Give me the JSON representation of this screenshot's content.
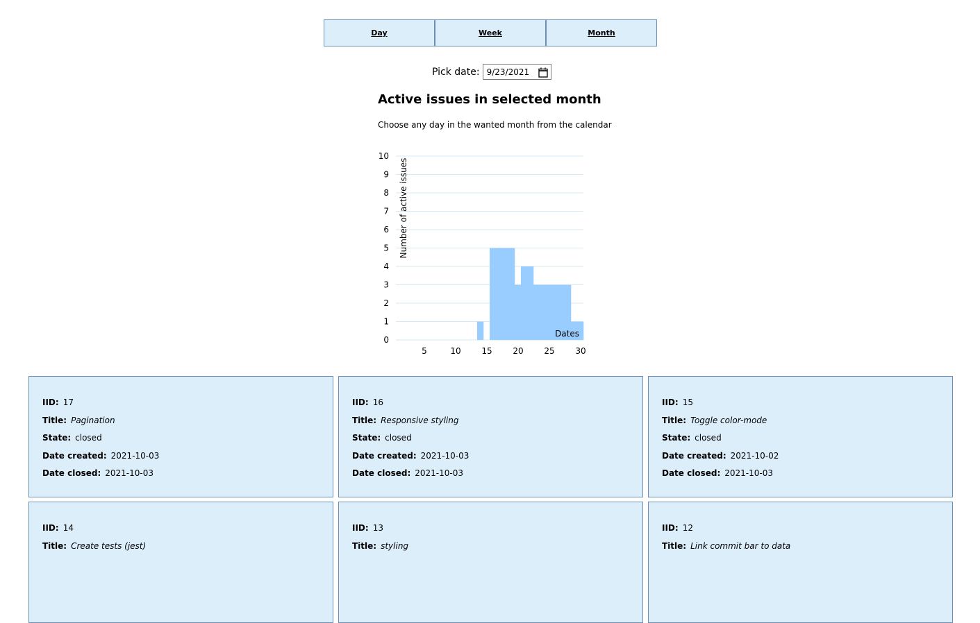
{
  "tabs": [
    {
      "label": "Day"
    },
    {
      "label": "Week"
    },
    {
      "label": "Month"
    }
  ],
  "datepicker": {
    "label": "Pick date:",
    "value": "9/23/2021",
    "icon": "calendar-icon"
  },
  "heading": "Active issues in selected month",
  "subtext": "Choose any day in the wanted month from the calendar",
  "labels": {
    "iid": "IID:",
    "title": "Title:",
    "state": "State:",
    "created": "Date created:",
    "closed": "Date closed:"
  },
  "chart_data": {
    "type": "area",
    "title": "",
    "xlabel": "Dates",
    "ylabel": "Number of active issues",
    "xlim": [
      1,
      30
    ],
    "ylim": [
      0,
      10
    ],
    "xticks": [
      5,
      10,
      15,
      20,
      25,
      30
    ],
    "yticks": [
      0,
      1,
      2,
      3,
      4,
      5,
      6,
      7,
      8,
      9,
      10
    ],
    "grid": true,
    "color": "#99ccff",
    "x": [
      1,
      2,
      3,
      4,
      5,
      6,
      7,
      8,
      9,
      10,
      11,
      12,
      13,
      14,
      15,
      16,
      17,
      18,
      19,
      20,
      21,
      22,
      23,
      24,
      25,
      26,
      27,
      28,
      29,
      30
    ],
    "y": [
      0,
      0,
      0,
      0,
      0,
      0,
      0,
      0,
      0,
      0,
      0,
      0,
      0,
      1,
      0,
      5,
      5,
      5,
      5,
      3,
      4,
      4,
      3,
      3,
      3,
      3,
      3,
      3,
      1,
      1
    ]
  },
  "cards": [
    {
      "iid": "17",
      "title": "Pagination",
      "state": "closed",
      "created": "2021-10-03",
      "closed": "2021-10-03"
    },
    {
      "iid": "16",
      "title": "Responsive styling",
      "state": "closed",
      "created": "2021-10-03",
      "closed": "2021-10-03"
    },
    {
      "iid": "15",
      "title": "Toggle color-mode",
      "state": "closed",
      "created": "2021-10-02",
      "closed": "2021-10-03"
    },
    {
      "iid": "14",
      "title": "Create tests (jest)"
    },
    {
      "iid": "13",
      "title": "styling"
    },
    {
      "iid": "12",
      "title": "Link commit bar to data"
    }
  ]
}
